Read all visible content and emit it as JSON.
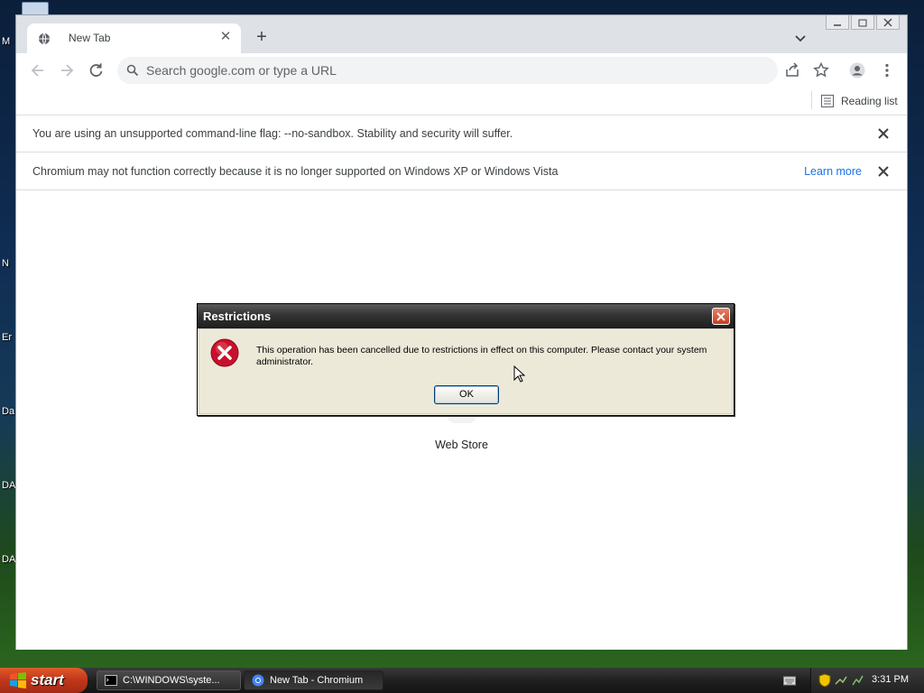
{
  "desktop": {
    "icon_labels": [
      "M",
      "N",
      "Er",
      "Da",
      "DA",
      "DA"
    ]
  },
  "browser": {
    "tab": {
      "title": "New Tab"
    },
    "omnibox": {
      "placeholder": "Search google.com or type a URL"
    },
    "bookmarks": {
      "reading_list": "Reading list"
    },
    "infobars": [
      {
        "text": "You are using an unsupported command-line flag: --no-sandbox. Stability and security will suffer."
      },
      {
        "text": "Chromium may not function correctly because it is no longer supported on Windows XP or Windows Vista",
        "link": "Learn more"
      }
    ],
    "content": {
      "webstore_label": "Web Store"
    }
  },
  "dialog": {
    "title": "Restrictions",
    "message": "This operation has been cancelled due to restrictions in effect on this computer. Please contact your system administrator.",
    "ok_label": "OK"
  },
  "taskbar": {
    "start_label": "start",
    "tasks": [
      {
        "label": "C:\\WINDOWS\\syste...",
        "icon": "cmd-icon"
      },
      {
        "label": "New Tab - Chromium",
        "icon": "chromium-icon"
      }
    ],
    "clock": "3:31 PM"
  },
  "colors": {
    "link": "#1a73e8",
    "tabstrip": "#dee1e6",
    "dialog_bg": "#ece9d8",
    "start_button": "#c0361a"
  }
}
